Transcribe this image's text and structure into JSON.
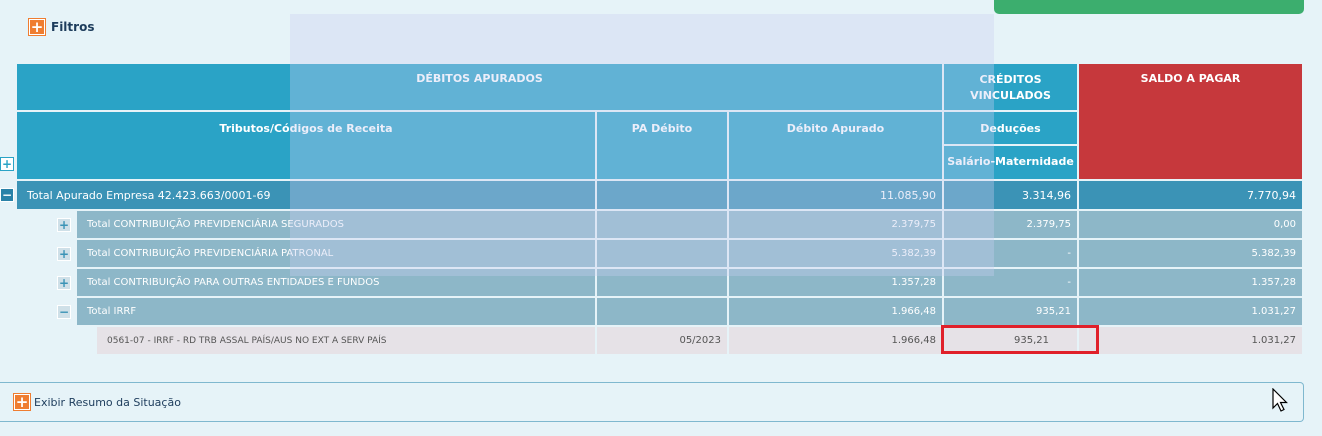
{
  "filters": {
    "label": "Filtros"
  },
  "headers": {
    "debitos_apurados": "DÉBITOS APURADOS",
    "creditos_vinculados": "CRÉDITOS VINCULADOS",
    "saldo_a_pagar": "SALDO A PAGAR",
    "tributos": "Tributos/Códigos de Receita",
    "pa_debito": "PA Débito",
    "debito_apurado": "Débito Apurado",
    "deducoes": "Deduções",
    "salario_maternidade": "Salário-Maternidade"
  },
  "rows": [
    {
      "label": "Total Apurado Empresa 42.423.663/0001-69",
      "pa": "",
      "debito": "11.085,90",
      "deducoes": "3.314,96",
      "saldo": "7.770,94"
    },
    {
      "label": "Total CONTRIBUIÇÃO PREVIDENCIÁRIA SEGURADOS",
      "pa": "",
      "debito": "2.379,75",
      "deducoes": "2.379,75",
      "saldo": "0,00"
    },
    {
      "label": "Total CONTRIBUIÇÃO PREVIDENCIÁRIA PATRONAL",
      "pa": "",
      "debito": "5.382,39",
      "deducoes": "-",
      "saldo": "5.382,39"
    },
    {
      "label": "Total CONTRIBUIÇÃO PARA OUTRAS ENTIDADES E FUNDOS",
      "pa": "",
      "debito": "1.357,28",
      "deducoes": "-",
      "saldo": "1.357,28"
    },
    {
      "label": "Total IRRF",
      "pa": "",
      "debito": "1.966,48",
      "deducoes": "935,21",
      "saldo": "1.031,27"
    },
    {
      "label": "0561-07 - IRRF - RD TRB ASSAL PAÍS/AUS NO EXT A SERV PAÍS",
      "pa": "05/2023",
      "debito": "1.966,48",
      "deducoes": "935,21",
      "saldo": "1.031,27"
    }
  ],
  "resumo": {
    "label": "Exibir Resumo da Situação"
  },
  "icons": {
    "expand": "+",
    "collapse": "−"
  },
  "colors": {
    "header_blue": "#2aa3c6",
    "saldo_red": "#c6383c",
    "highlight_red": "#e0202a",
    "accent_orange": "#ef7d31"
  }
}
